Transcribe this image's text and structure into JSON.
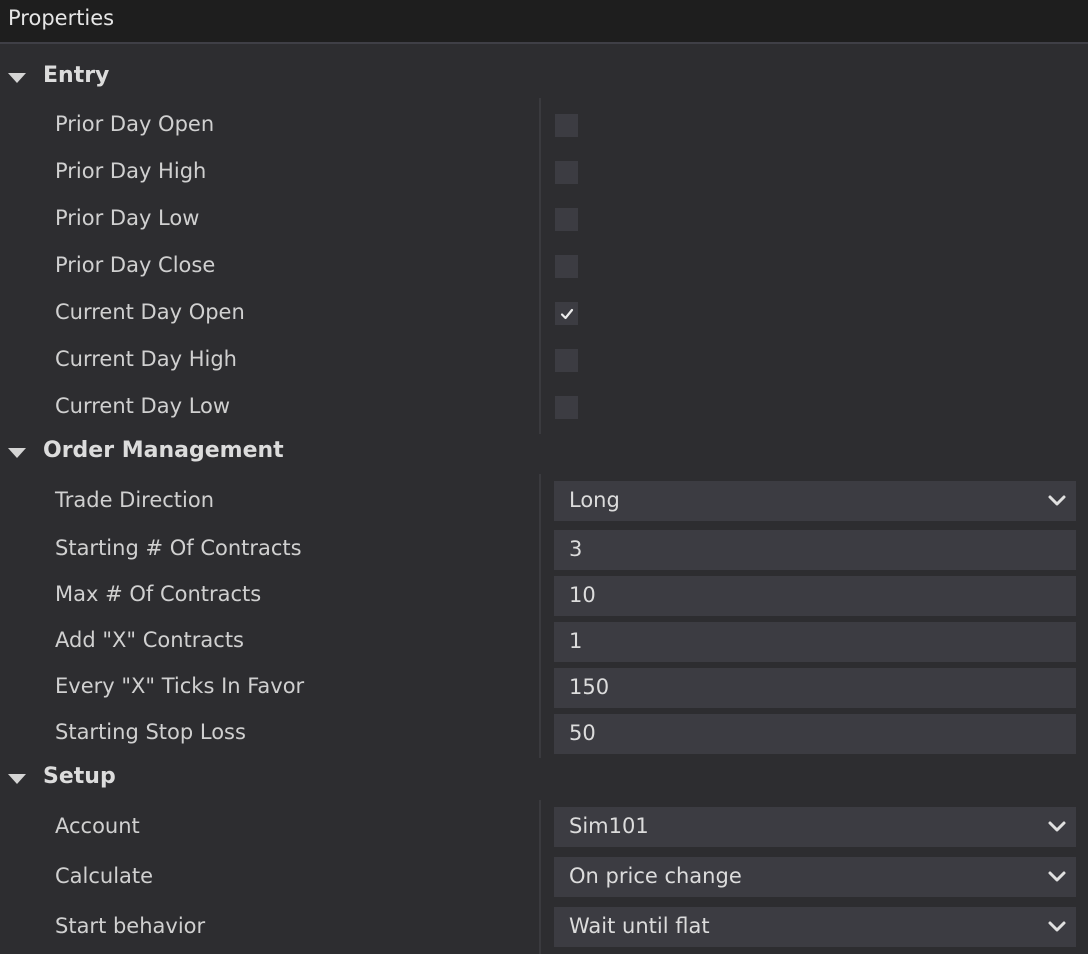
{
  "window": {
    "title": "Properties"
  },
  "sections": {
    "entry": {
      "label": "Entry",
      "items": [
        {
          "label": "Prior Day Open",
          "checked": false
        },
        {
          "label": "Prior Day High",
          "checked": false
        },
        {
          "label": "Prior Day Low",
          "checked": false
        },
        {
          "label": "Prior Day Close",
          "checked": false
        },
        {
          "label": "Current Day Open",
          "checked": true
        },
        {
          "label": "Current Day High",
          "checked": false
        },
        {
          "label": "Current Day Low",
          "checked": false
        }
      ]
    },
    "order_management": {
      "label": "Order Management",
      "items": [
        {
          "label": "Trade Direction",
          "value": "Long",
          "type": "dropdown"
        },
        {
          "label": "Starting # Of Contracts",
          "value": "3",
          "type": "input"
        },
        {
          "label": "Max # Of Contracts",
          "value": "10",
          "type": "input"
        },
        {
          "label": "Add \"X\" Contracts",
          "value": "1",
          "type": "input"
        },
        {
          "label": "Every \"X\" Ticks In Favor",
          "value": "150",
          "type": "input"
        },
        {
          "label": "Starting Stop Loss",
          "value": "50",
          "type": "input"
        }
      ]
    },
    "setup": {
      "label": "Setup",
      "items": [
        {
          "label": "Account",
          "value": "Sim101",
          "type": "dropdown"
        },
        {
          "label": "Calculate",
          "value": "On price change",
          "type": "dropdown"
        },
        {
          "label": "Start behavior",
          "value": "Wait until flat",
          "type": "dropdown"
        }
      ]
    }
  },
  "icons": {
    "collapse": "triangle-down-icon",
    "dropdown": "chevron-down-icon",
    "check": "checkmark-icon"
  },
  "colors": {
    "background": "#2d2d30",
    "titlebar": "#1e1e1e",
    "field": "#3c3c42",
    "text": "#dcdcdc"
  }
}
